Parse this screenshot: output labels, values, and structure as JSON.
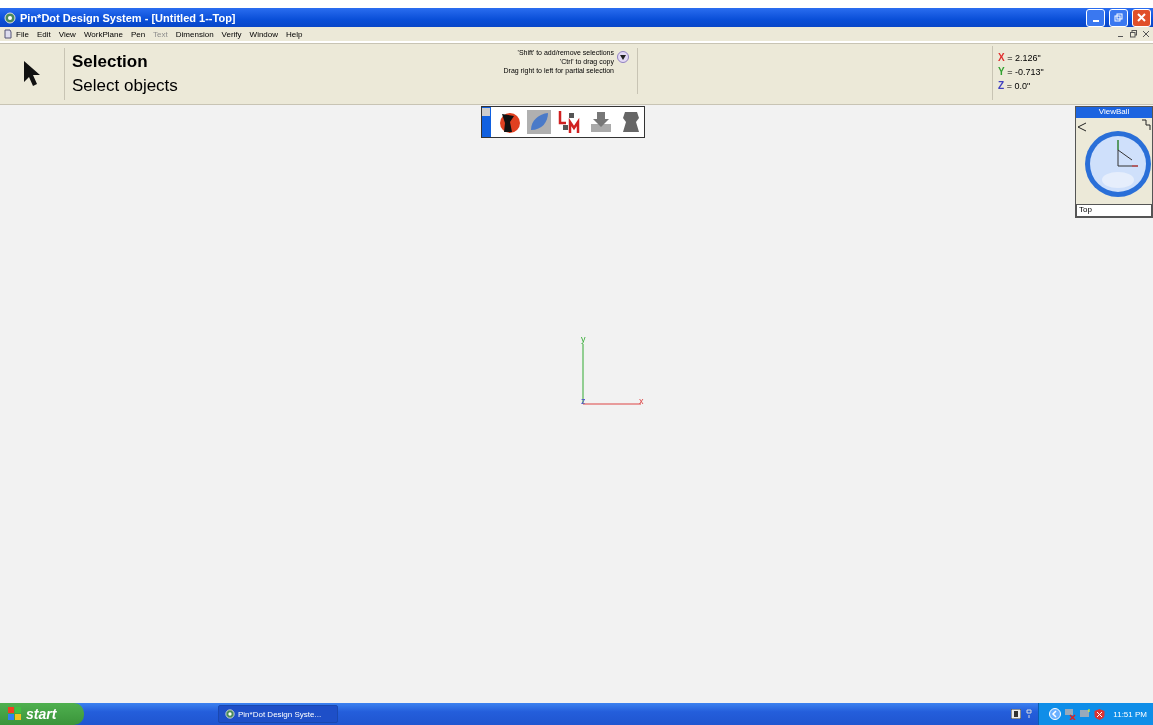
{
  "window": {
    "title": "Pin*Dot Design System - [Untitled 1--Top]"
  },
  "menu": [
    {
      "label": "File",
      "disabled": false
    },
    {
      "label": "Edit",
      "disabled": false
    },
    {
      "label": "View",
      "disabled": false
    },
    {
      "label": "WorkPlane",
      "disabled": false
    },
    {
      "label": "Pen",
      "disabled": false
    },
    {
      "label": "Text",
      "disabled": true
    },
    {
      "label": "Dimension",
      "disabled": false
    },
    {
      "label": "Verify",
      "disabled": false
    },
    {
      "label": "Window",
      "disabled": false
    },
    {
      "label": "Help",
      "disabled": false
    }
  ],
  "tool": {
    "name": "Selection",
    "description": "Select objects"
  },
  "hints": [
    "'Shift' to add/remove selections",
    "'Ctrl' to drag copy",
    "Drag right to left for partial selection"
  ],
  "coordinates": [
    {
      "axis": "X",
      "value": "= 2.126\"",
      "color": "#e03030"
    },
    {
      "axis": "Y",
      "value": "= -0.713\"",
      "color": "#30a030"
    },
    {
      "axis": "Z",
      "value": "= 0.0\"",
      "color": "#4040c0"
    }
  ],
  "palette": [
    {
      "kind": "figure"
    },
    {
      "kind": "drop"
    },
    {
      "kind": "lm"
    },
    {
      "kind": "download"
    },
    {
      "kind": "shape"
    }
  ],
  "viewball": {
    "title": "ViewBall",
    "view": "Top"
  },
  "axes": {
    "y": "y",
    "z": "z",
    "x": "x"
  },
  "taskbar": {
    "start": "start",
    "task": "Pin*Dot Design Syste...",
    "clock": "11:51 PM"
  }
}
